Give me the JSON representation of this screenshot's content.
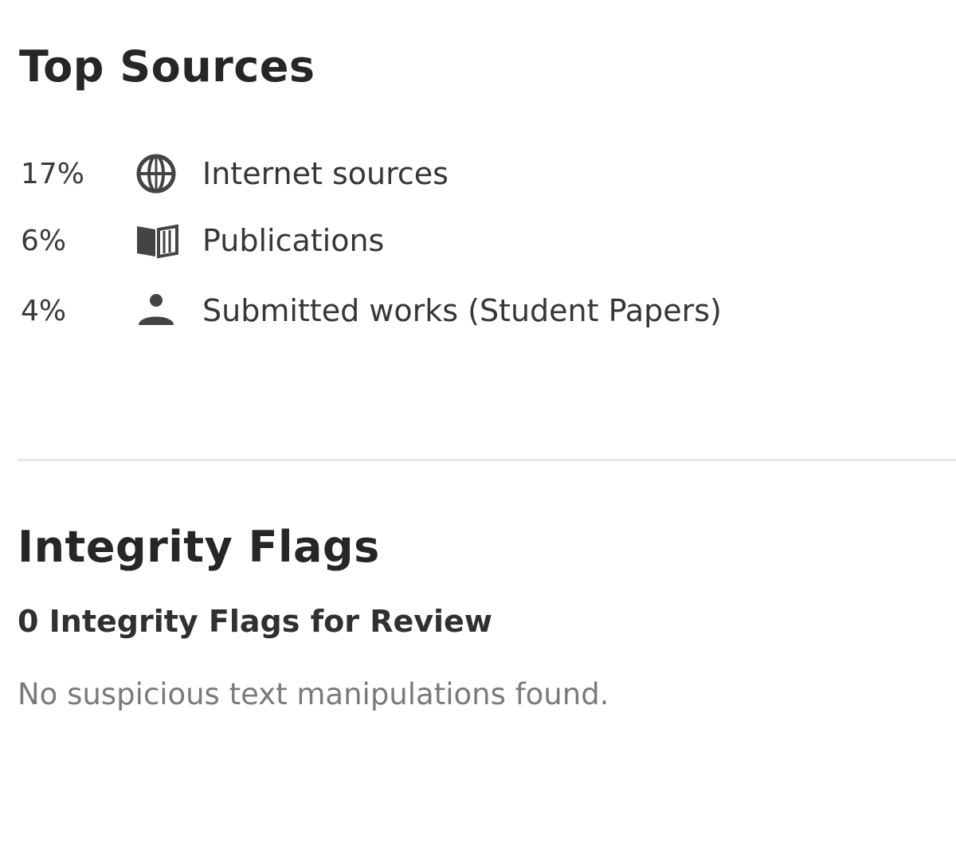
{
  "top_sources": {
    "title": "Top Sources",
    "items": [
      {
        "percent": "17%",
        "icon": "globe-icon",
        "label": "Internet sources"
      },
      {
        "percent": "6%",
        "icon": "book-icon",
        "label": "Publications"
      },
      {
        "percent": "4%",
        "icon": "person-icon",
        "label": "Submitted works (Student Papers)"
      }
    ]
  },
  "integrity_flags": {
    "title": "Integrity Flags",
    "count_text": "0 Integrity Flags for Review",
    "note": "No suspicious text manipulations found."
  }
}
